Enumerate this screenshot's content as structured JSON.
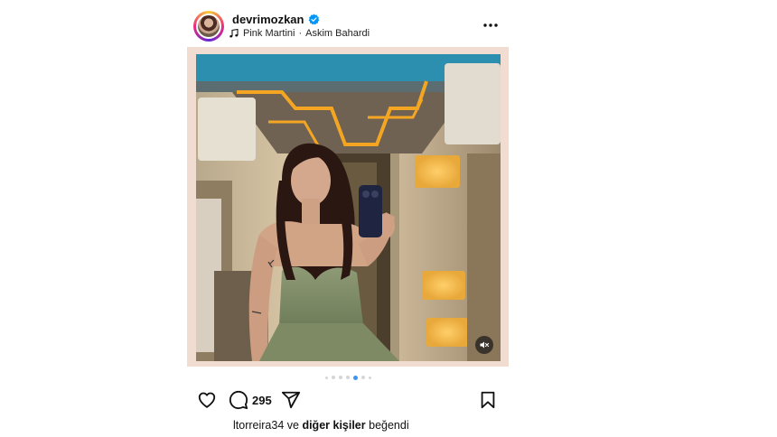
{
  "header": {
    "username": "devrimozkan",
    "song_artist": "Pink Martini",
    "song_separator": "·",
    "song_title": "Askim Bahardi"
  },
  "icons": {
    "verified": "verified-badge-icon",
    "music": "music-note-icon",
    "more": "more-options-icon",
    "mute": "muted-speaker-icon",
    "like": "heart-icon",
    "comment": "comment-icon",
    "share": "send-icon",
    "save": "bookmark-icon"
  },
  "carousel": {
    "total_slides": 7,
    "active_index": 4
  },
  "actions": {
    "comment_count": "295"
  },
  "likes": {
    "user": "ltorreira34",
    "connector": "ve",
    "others": "diğer kişiler",
    "suffix": "beğendi"
  },
  "colors": {
    "verified_blue": "#0095f6",
    "active_dot": "#3897f0",
    "frame_tint": "#f1dcd2"
  }
}
